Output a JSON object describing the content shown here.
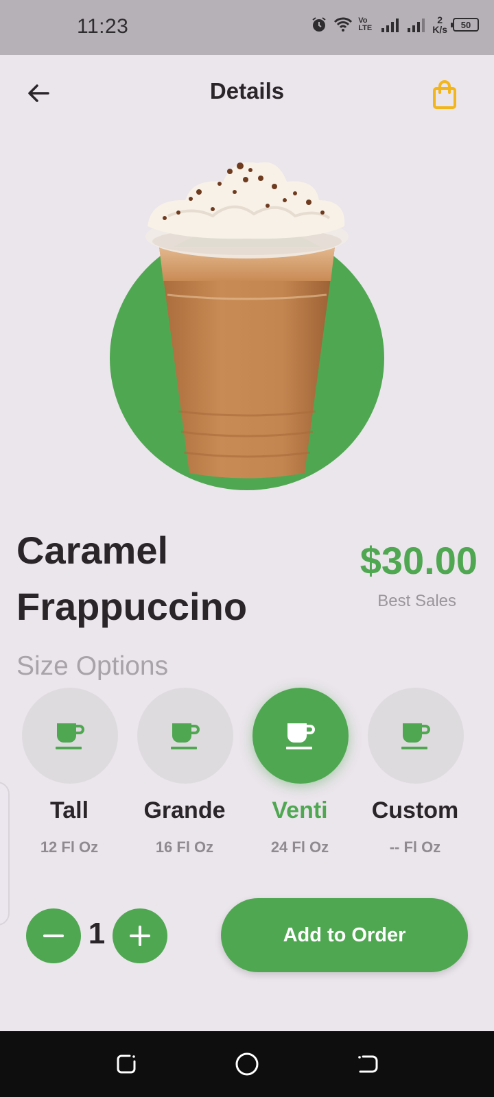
{
  "status_bar": {
    "time": "11:23",
    "volte_label": "Vo LTE",
    "net_speed_value": "2",
    "net_speed_unit": "K/s",
    "battery_level": "50"
  },
  "header": {
    "title": "Details",
    "back_icon": "arrow-left-icon",
    "bag_icon": "shopping-bag-icon",
    "bag_color": "#f2b51b"
  },
  "product": {
    "name_line1": "Caramel",
    "name_line2": "Frappuccino",
    "price": "$30.00",
    "tag": "Best Sales"
  },
  "sizes": {
    "heading": "Size Options",
    "options": [
      {
        "name": "Tall",
        "volume": "12 Fl Oz",
        "selected": false,
        "icon": "cup-icon"
      },
      {
        "name": "Grande",
        "volume": "16 Fl Oz",
        "selected": false,
        "icon": "cup-icon"
      },
      {
        "name": "Venti",
        "volume": "24 Fl Oz",
        "selected": true,
        "icon": "cup-icon"
      },
      {
        "name": "Custom",
        "volume": "-- Fl Oz",
        "selected": false,
        "icon": "cup-icon"
      }
    ]
  },
  "quantity": {
    "value": "1",
    "minus_icon": "minus-icon",
    "plus_icon": "plus-icon"
  },
  "actions": {
    "add_to_order": "Add to Order"
  },
  "colors": {
    "accent": "#4fa851",
    "background": "#ebe5ec",
    "text_dark": "#2a2529",
    "text_muted": "#a8a3a9"
  }
}
